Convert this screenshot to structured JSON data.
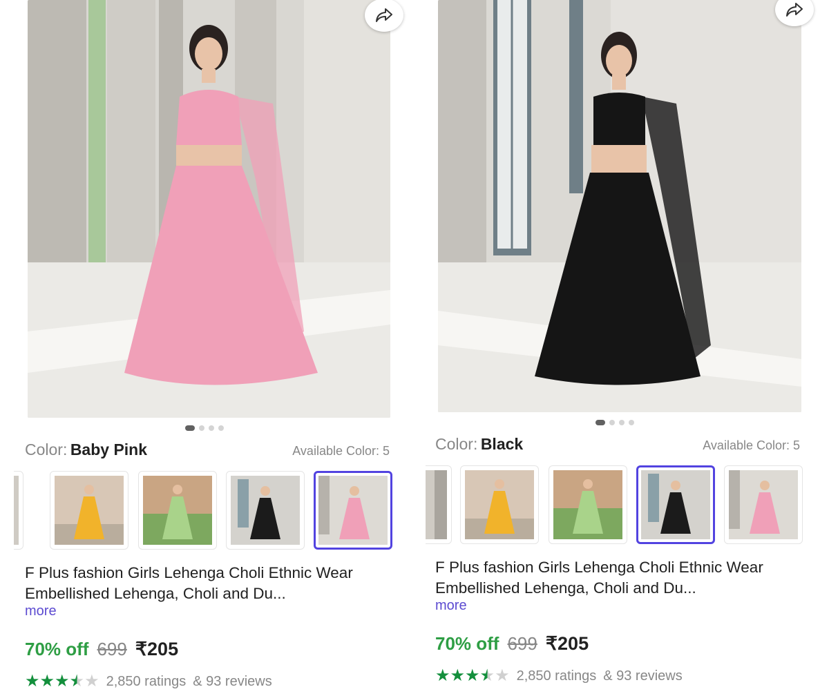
{
  "panels": [
    {
      "color_label": "Color:",
      "color_value": "Baby Pink",
      "available": "Available Color: 5",
      "title": "F Plus fashion Girls Lehenga Choli Ethnic Wear Embellished Lehenga, Choli and Du...",
      "more": "more",
      "discount": "70% off",
      "mrp": "699",
      "price": "₹205",
      "rating_value": 3.5,
      "ratings": "2,850 ratings",
      "reviews": "& 93 reviews",
      "dress_color": "#f0a0b8",
      "image_dot_active": 0,
      "image_dot_count": 4,
      "thumbnails": [
        {
          "dress": "#6b6b6b",
          "selected": false
        },
        {
          "dress": "#f1b32b",
          "selected": false
        },
        {
          "dress": "#a9d38a",
          "selected": false
        },
        {
          "dress": "#1b1b1b",
          "selected": false
        },
        {
          "dress": "#f0a0b8",
          "selected": true
        }
      ]
    },
    {
      "color_label": "Color:",
      "color_value": "Black",
      "available": "Available Color: 5",
      "title": "F Plus fashion Girls Lehenga Choli Ethnic Wear Embellished Lehenga, Choli and Du...",
      "more": "more",
      "discount": "70% off",
      "mrp": "699",
      "price": "₹205",
      "rating_value": 3.5,
      "ratings": "2,850 ratings",
      "reviews": "& 93 reviews",
      "dress_color": "#151515",
      "image_dot_active": 0,
      "image_dot_count": 4,
      "thumbnails": [
        {
          "dress": "#6b6b6b",
          "selected": false
        },
        {
          "dress": "#f1b32b",
          "selected": false
        },
        {
          "dress": "#a9d38a",
          "selected": false
        },
        {
          "dress": "#1b1b1b",
          "selected": true
        },
        {
          "dress": "#f0a0b8",
          "selected": false
        }
      ]
    }
  ],
  "icons": {
    "share": "share-icon",
    "star": "star-icon"
  }
}
